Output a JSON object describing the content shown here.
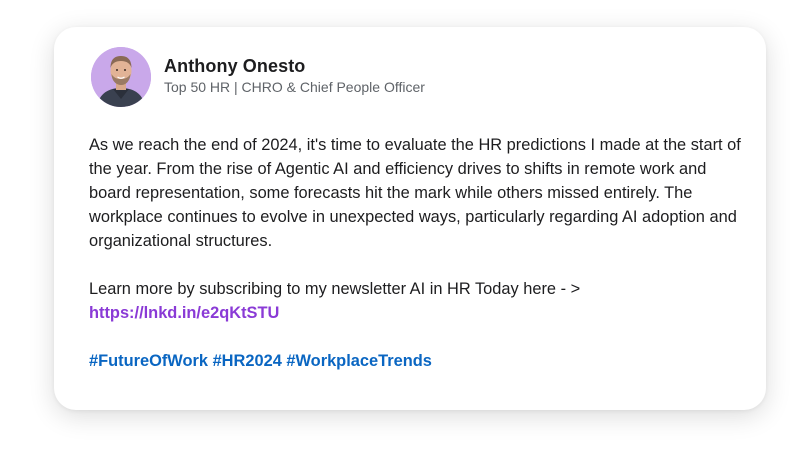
{
  "post": {
    "author": {
      "name": "Anthony Onesto",
      "headline": "Top 50 HR | CHRO & Chief People Officer",
      "avatar_icon": "profile-photo"
    },
    "body_paragraph_1": "As we reach the end of 2024, it's time to evaluate the HR predictions I made at the start of the year. From the rise of Agentic AI and efficiency drives to shifts in remote work and board representation, some forecasts hit the mark while others missed entirely. The workplace continues to evolve in unexpected ways, particularly regarding AI adoption and organizational structures.",
    "body_paragraph_2_text": "Learn more by subscribing to my newsletter AI in HR Today here - >",
    "link_text": "https://lnkd.in/e2qKtSTU",
    "hashtags": [
      "#FutureOfWork",
      "#HR2024",
      "#WorkplaceTrends"
    ]
  },
  "colors": {
    "link": "#8a3ad6",
    "hashtag": "#0a66c2",
    "text": "#1d1d1f",
    "muted": "#5f6368",
    "avatar_bg": "#c7a6e8"
  }
}
